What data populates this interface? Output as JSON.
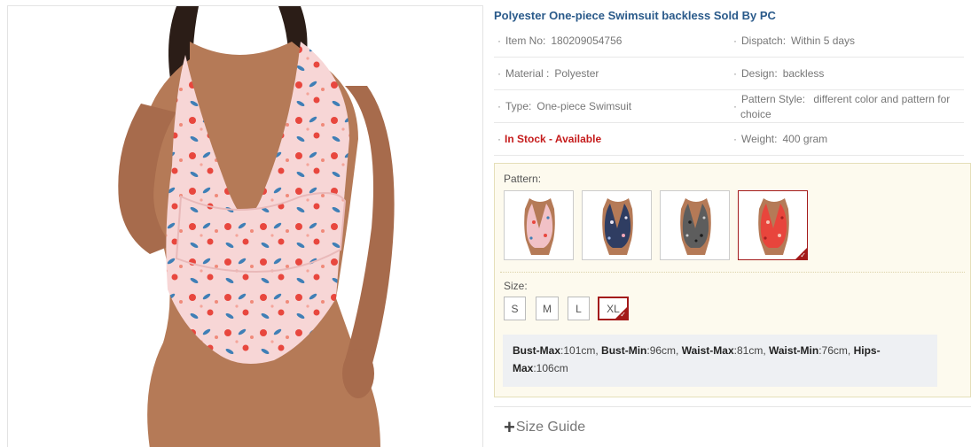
{
  "product": {
    "title": "Polyester One-piece Swimsuit backless Sold By PC",
    "image_alt": "Floral halter one-piece swimsuit on model"
  },
  "specs": [
    {
      "left": {
        "label": "Item No:",
        "value": "180209054756"
      },
      "right": {
        "label": "Dispatch:",
        "value": "Within 5 days"
      }
    },
    {
      "left": {
        "label": "Material :",
        "value": "Polyester"
      },
      "right": {
        "label": "Design:",
        "value": "backless"
      }
    },
    {
      "left": {
        "label": "Type:",
        "value": "One-piece Swimsuit"
      },
      "right": {
        "label": "Pattern Style:",
        "value": "different color and pattern for choice"
      }
    },
    {
      "left": {
        "label": "",
        "value": "In Stock - Available"
      },
      "right": {
        "label": "Weight:",
        "value": "400 gram"
      }
    }
  ],
  "pattern": {
    "label": "Pattern:",
    "options": [
      {
        "name": "Pink floral",
        "selected": false
      },
      {
        "name": "Blue floral",
        "selected": false
      },
      {
        "name": "Leopard print",
        "selected": false
      },
      {
        "name": "Red floral",
        "selected": true
      }
    ]
  },
  "size": {
    "label": "Size:",
    "options": [
      "S",
      "M",
      "L",
      "XL"
    ],
    "selected": "XL"
  },
  "measurements": {
    "bust_max_label": "Bust-Max",
    "bust_max": ":101cm,",
    "bust_min_label": "Bust-Min",
    "bust_min": ":96cm,",
    "waist_max_label": "Waist-Max",
    "waist_max": ":81cm,",
    "waist_min_label": "Waist-Min",
    "waist_min": ":76cm,",
    "hips_max_label_a": "Hips-",
    "hips_max_label_b": "Max",
    "hips_max": ":106cm"
  },
  "size_guide": {
    "icon": "plus-icon",
    "label": "Size Guide"
  },
  "colors": {
    "title": "#2a5a8a",
    "stock": "#c51c1c",
    "selected_border": "#a31a1a",
    "options_bg": "#fdfaee"
  }
}
